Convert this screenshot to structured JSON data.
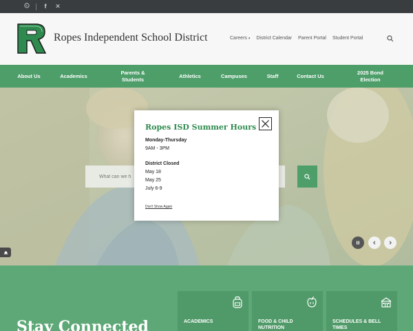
{
  "utility": {
    "icons": [
      "whatsapp-icon",
      "facebook-icon",
      "x-icon"
    ]
  },
  "header": {
    "title": "Ropes Independent School District",
    "logo_letter": "R",
    "links": [
      "Careers",
      "District Calendar",
      "Parent Portal",
      "Student Portal"
    ],
    "careers_caret": "▾"
  },
  "nav": {
    "items": [
      "About Us",
      "Academics",
      "Parents & Students",
      "Athletics",
      "Campuses",
      "Staff",
      "Contact Us",
      "2025 Bond Election"
    ]
  },
  "hero": {
    "search_placeholder": "What can we h"
  },
  "modal": {
    "title": "Ropes ISD Summer Hours",
    "days_label": "Monday-Thursday",
    "hours": "9AM - 3PM",
    "closed_label": "District Closed",
    "closed_dates": [
      "May 18",
      "May 25",
      "July 6-9"
    ],
    "dont_show": "Don't Show Again"
  },
  "lower": {
    "heading": "Stay Connected",
    "tiles": [
      "Academics",
      "Food & Child Nutrition",
      "Schedules & Bell Times"
    ]
  },
  "colors": {
    "brand_green": "#4e9e6a",
    "title_green": "#2e8a4e",
    "utility_bar": "#3a3d3f"
  }
}
